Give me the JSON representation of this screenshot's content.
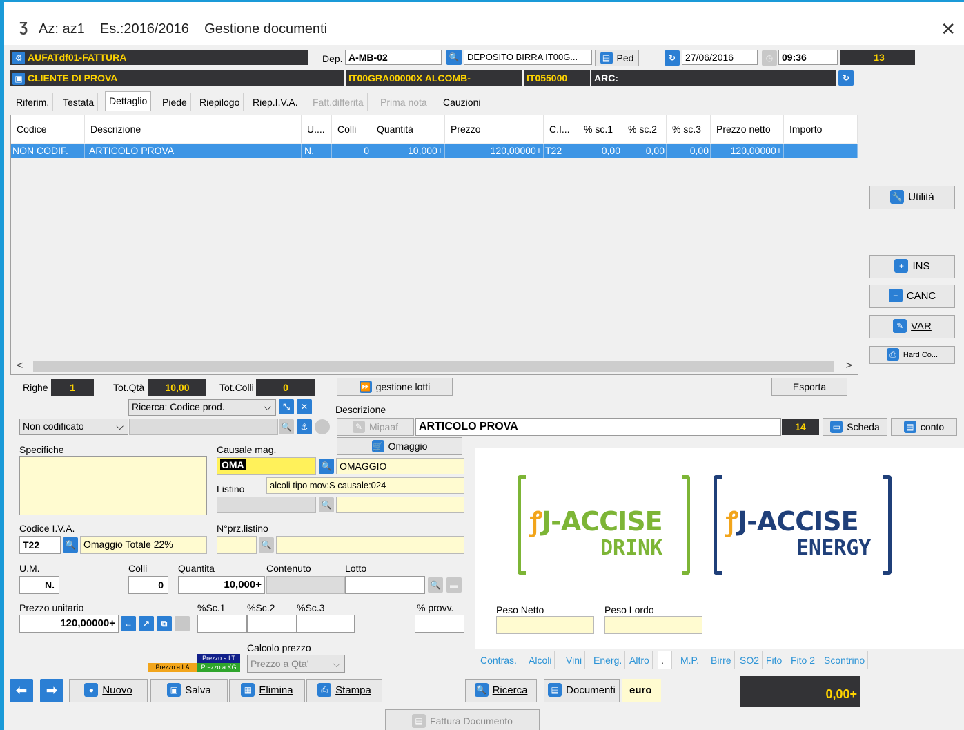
{
  "window": {
    "title": "Az: az1    Es.:2016/2016    Gestione documenti",
    "close": "✕"
  },
  "header": {
    "doc_type": "AUFATdf01-FATTURA",
    "dep_label": "Dep.",
    "dep_code": "A-MB-02",
    "dep_desc": "DEPOSITO BIRRA IT00G...",
    "ped_label": "Ped",
    "date": "27/06/2016",
    "time": "09:36",
    "counter": "13",
    "client": "CLIENTE DI PROVA",
    "client_code": "IT00GRA00000X ALCOMB-",
    "client_code2": "IT055000",
    "arc_label": "ARC:"
  },
  "tabs": [
    {
      "label": "Riferim."
    },
    {
      "label": "Testata"
    },
    {
      "label": "Dettaglio"
    },
    {
      "label": "Piede"
    },
    {
      "label": "Riepilogo"
    },
    {
      "label": "Riep.I.V.A."
    },
    {
      "label": "Fatt.differita"
    },
    {
      "label": "Prima nota"
    },
    {
      "label": "Cauzioni"
    }
  ],
  "grid": {
    "headers": [
      "Codice",
      "Descrizione",
      "U....",
      "Colli",
      "Quantità",
      "Prezzo",
      "C.I...",
      "% sc.1",
      "% sc.2",
      "% sc.3",
      "Prezzo netto",
      "Importo"
    ],
    "rows": [
      [
        "NON CODIF.",
        "ARTICOLO PROVA",
        "N.",
        "0",
        "10,000+",
        "120,00000+",
        "T22",
        "0,00",
        "0,00",
        "0,00",
        "120,00000+",
        ""
      ]
    ]
  },
  "side_buttons": {
    "utilita": "Utilità",
    "ins": "INS",
    "canc": "CANC",
    "var": "VAR",
    "hard": "Hard Co..."
  },
  "totals": {
    "righe_label": "Righe",
    "righe": "1",
    "totqta_label": "Tot.Qtà",
    "totqta": "10,00",
    "totcolli_label": "Tot.Colli",
    "totcolli": "0",
    "lotti_button": "gestione lotti",
    "esporta_button": "Esporta"
  },
  "detail": {
    "ricerca_select": "Ricerca: Codice prod.",
    "descrizione_label": "Descrizione",
    "non_codificato": "Non codificato",
    "mipaaf": "Mipaaf",
    "descrizione_value": "ARTICOLO PROVA",
    "desc_count": "14",
    "scheda_button": "Scheda",
    "conto_button": "conto",
    "specifiche_label": "Specifiche",
    "causale_label": "Causale mag.",
    "causale_code": "OMA",
    "causale_desc": "OMAGGIO",
    "omaggio_button": "Omaggio",
    "listino_label": "Listino",
    "listino_note": "alcoli tipo mov:S causale:024",
    "iva_label": "Codice I.V.A.",
    "iva_code": "T22",
    "iva_desc": "Omaggio Totale 22%",
    "nprz_label": "N°prz.listino",
    "um_label": "U.M.",
    "um_value": "N.",
    "colli_label": "Colli",
    "colli_value": "0",
    "quantita_label": "Quantita",
    "quantita_value": "10,000+",
    "contenuto_label": "Contenuto",
    "lotto_label": "Lotto",
    "prezzo_label": "Prezzo unitario",
    "prezzo_value": "120,00000+",
    "sc1_label": "%Sc.1",
    "sc2_label": "%Sc.2",
    "sc3_label": "%Sc.3",
    "provv_label": "% provv.",
    "calcolo_label": "Calcolo prezzo",
    "prezzo_la": "Prezzo a LA",
    "prezzo_lt": "Prezzo a LT",
    "prezzo_kg": "Prezzo a KG",
    "calcolo_select": "Prezzo a  Qta'"
  },
  "logo": {
    "left_brand": "J-ACCISE",
    "left_sub": "DRINK",
    "right_brand": "J-ACCISE",
    "right_sub": "ENERGY"
  },
  "peso": {
    "netto_label": "Peso Netto",
    "lordo_label": "Peso Lordo"
  },
  "subtabs": [
    "Contras.",
    "Alcoli",
    "Vini",
    "Energ.",
    "Altro",
    ".",
    "M.P.",
    "Birre",
    "SO2",
    "Fito",
    "Fito 2",
    "Scontrino"
  ],
  "bottom": {
    "nuovo": "Nuovo",
    "salva": "Salva",
    "elimina": "Elimina",
    "stampa": "Stampa",
    "ricerca": "Ricerca",
    "documenti": "Documenti",
    "currency": "euro",
    "total": "0,00+",
    "fattura": "Fattura Documento"
  },
  "colors": {
    "accent": "#1a9ad8",
    "dark": "#333336",
    "yellow": "#ffd400",
    "selection": "#3d95e5",
    "drink_green": "#7db536",
    "energy_navy": "#1f3f79",
    "orange": "#f2a51b"
  }
}
